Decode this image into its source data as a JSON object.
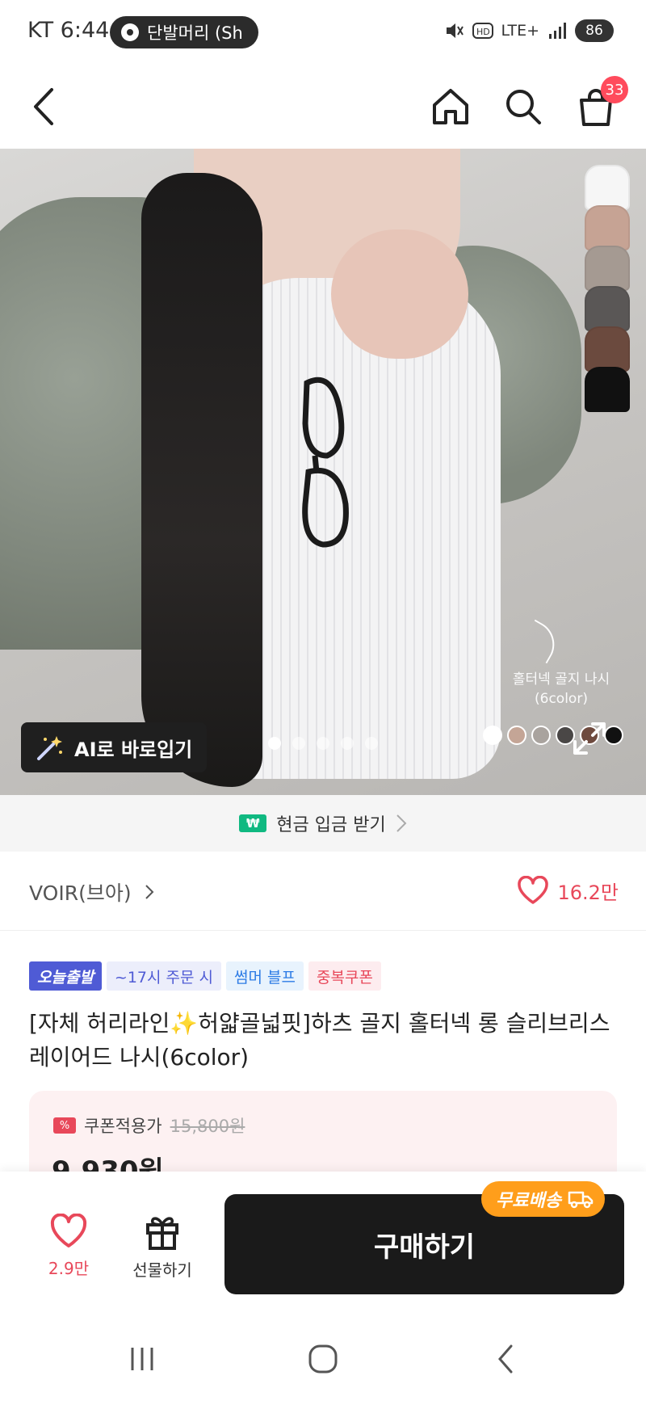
{
  "status_bar": {
    "carrier_time": "KT 6:44",
    "media_pill": "단발머리 (Sh",
    "network": "LTE+",
    "battery": "86"
  },
  "top_nav": {
    "cart_count": "33"
  },
  "hero": {
    "caption_line1": "홀터넥 골지 나시",
    "caption_line2": "(6color)",
    "swatch_colors": [
      "#ffffff",
      "#c4a596",
      "#a9a39e",
      "#4a4746",
      "#6e4a3e",
      "#111111"
    ],
    "ai_button_label": "AI로 바로입기",
    "carousel_total": 5,
    "carousel_active": 1
  },
  "cash_banner": {
    "icon_label": "₩",
    "text": "현금 입금 받기"
  },
  "brand": {
    "name": "VOIR(브아)",
    "likes": "16.2만"
  },
  "product": {
    "badges": [
      "오늘출발",
      "~17시 주문 시",
      "썸머 블프",
      "중복쿠폰"
    ],
    "title": "[자체 허리라인✨허얇골넓핏]하츠 골지 홀터넥 롱 슬리브리스 레이어드 나시(6color)",
    "coupon_label": "쿠폰적용가",
    "original_price": "15,800원",
    "sale_price": "9,930원"
  },
  "bottom_bar": {
    "like_count": "2.9만",
    "gift_label": "선물하기",
    "buy_label": "구매하기",
    "free_shipping_label": "무료배송"
  },
  "colors": {
    "accent_red": "#e8485a",
    "badge_blue": "#4f5bd5",
    "buy_button": "#1a1a1a",
    "free_shipping": "#ff9e1b",
    "cash_green": "#10b981"
  }
}
